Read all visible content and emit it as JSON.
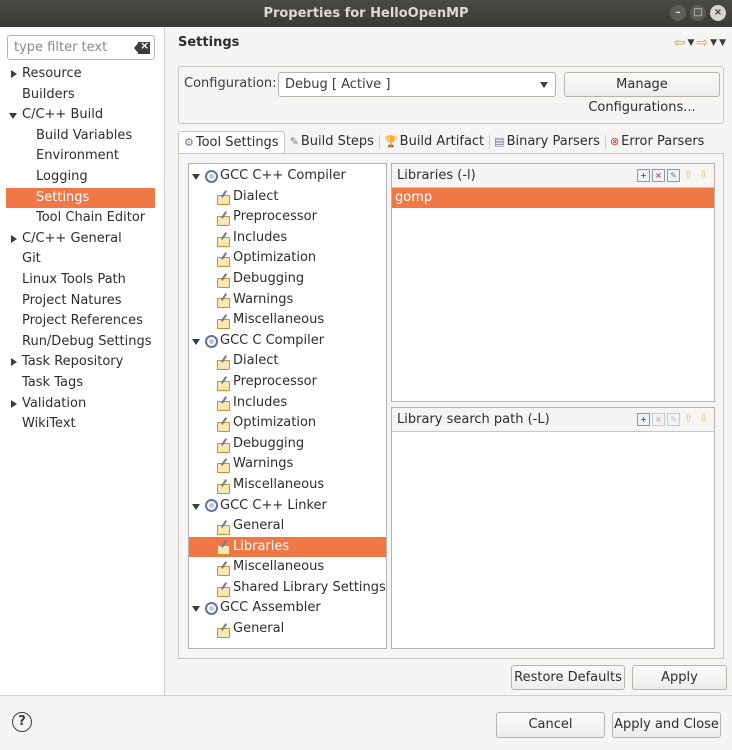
{
  "window": {
    "title": "Properties for HelloOpenMP",
    "buttons": {
      "minimize": "–",
      "maximize": "□",
      "close": "×"
    }
  },
  "sidebar": {
    "filter_placeholder": "type filter text",
    "items": [
      {
        "label": "Resource",
        "level": 0,
        "expander": "collapsed"
      },
      {
        "label": "Builders",
        "level": 0,
        "expander": "none"
      },
      {
        "label": "C/C++ Build",
        "level": 0,
        "expander": "expanded"
      },
      {
        "label": "Build Variables",
        "level": 1,
        "expander": "none"
      },
      {
        "label": "Environment",
        "level": 1,
        "expander": "none"
      },
      {
        "label": "Logging",
        "level": 1,
        "expander": "none"
      },
      {
        "label": "Settings",
        "level": 1,
        "expander": "none",
        "selected": true
      },
      {
        "label": "Tool Chain Editor",
        "level": 1,
        "expander": "none"
      },
      {
        "label": "C/C++ General",
        "level": 0,
        "expander": "collapsed"
      },
      {
        "label": "Git",
        "level": 0,
        "expander": "none"
      },
      {
        "label": "Linux Tools Path",
        "level": 0,
        "expander": "none"
      },
      {
        "label": "Project Natures",
        "level": 0,
        "expander": "none"
      },
      {
        "label": "Project References",
        "level": 0,
        "expander": "none"
      },
      {
        "label": "Run/Debug Settings",
        "level": 0,
        "expander": "none"
      },
      {
        "label": "Task Repository",
        "level": 0,
        "expander": "collapsed"
      },
      {
        "label": "Task Tags",
        "level": 0,
        "expander": "none"
      },
      {
        "label": "Validation",
        "level": 0,
        "expander": "collapsed"
      },
      {
        "label": "WikiText",
        "level": 0,
        "expander": "none"
      }
    ]
  },
  "main": {
    "heading": "Settings",
    "nav_icons": {
      "back": "⇦",
      "forward": "⇨",
      "dropdown": "▼",
      "menu": "▼"
    },
    "config": {
      "label": "Configuration:",
      "value": "Debug  [ Active ]",
      "manage_label": "Manage Configurations..."
    },
    "tabs": [
      {
        "label": "Tool Settings",
        "icon": "tool-settings-icon",
        "glyph": "⚙",
        "active": true
      },
      {
        "label": "Build Steps",
        "icon": "build-steps-icon",
        "glyph": "✎"
      },
      {
        "label": "Build Artifact",
        "icon": "build-artifact-icon",
        "glyph": "🏆"
      },
      {
        "label": "Binary Parsers",
        "icon": "binary-parsers-icon",
        "glyph": "▤"
      },
      {
        "label": "Error Parsers",
        "icon": "error-parsers-icon",
        "glyph": "⊗"
      }
    ],
    "tool_tree": [
      {
        "label": "GCC C++ Compiler",
        "level": 0
      },
      {
        "label": "Dialect",
        "level": 1
      },
      {
        "label": "Preprocessor",
        "level": 1
      },
      {
        "label": "Includes",
        "level": 1
      },
      {
        "label": "Optimization",
        "level": 1
      },
      {
        "label": "Debugging",
        "level": 1
      },
      {
        "label": "Warnings",
        "level": 1
      },
      {
        "label": "Miscellaneous",
        "level": 1
      },
      {
        "label": "GCC C Compiler",
        "level": 0
      },
      {
        "label": "Dialect",
        "level": 1
      },
      {
        "label": "Preprocessor",
        "level": 1
      },
      {
        "label": "Includes",
        "level": 1
      },
      {
        "label": "Optimization",
        "level": 1
      },
      {
        "label": "Debugging",
        "level": 1
      },
      {
        "label": "Warnings",
        "level": 1
      },
      {
        "label": "Miscellaneous",
        "level": 1
      },
      {
        "label": "GCC C++ Linker",
        "level": 0
      },
      {
        "label": "General",
        "level": 1
      },
      {
        "label": "Libraries",
        "level": 1,
        "selected": true
      },
      {
        "label": "Miscellaneous",
        "level": 1
      },
      {
        "label": "Shared Library Settings",
        "level": 1
      },
      {
        "label": "GCC Assembler",
        "level": 0
      },
      {
        "label": "General",
        "level": 1
      }
    ],
    "libraries": {
      "title": "Libraries (-l)",
      "items": [
        "gomp"
      ],
      "tool_glyphs": {
        "add": "+",
        "delete": "×",
        "edit": "✎",
        "up": "⇧",
        "down": "⇩"
      }
    },
    "search_path": {
      "title": "Library search path (-L)",
      "items": [],
      "tool_glyphs": {
        "add": "+",
        "delete": "×",
        "edit": "✎",
        "up": "⇧",
        "down": "⇩"
      }
    },
    "restore_label": "Restore Defaults",
    "apply_label": "Apply"
  },
  "footer": {
    "help_glyph": "?",
    "cancel_label": "Cancel",
    "apply_close_label": "Apply and Close"
  },
  "colors": {
    "selection": "#f07746",
    "titlebar": "#3b3a36",
    "background": "#f6f5f4"
  }
}
